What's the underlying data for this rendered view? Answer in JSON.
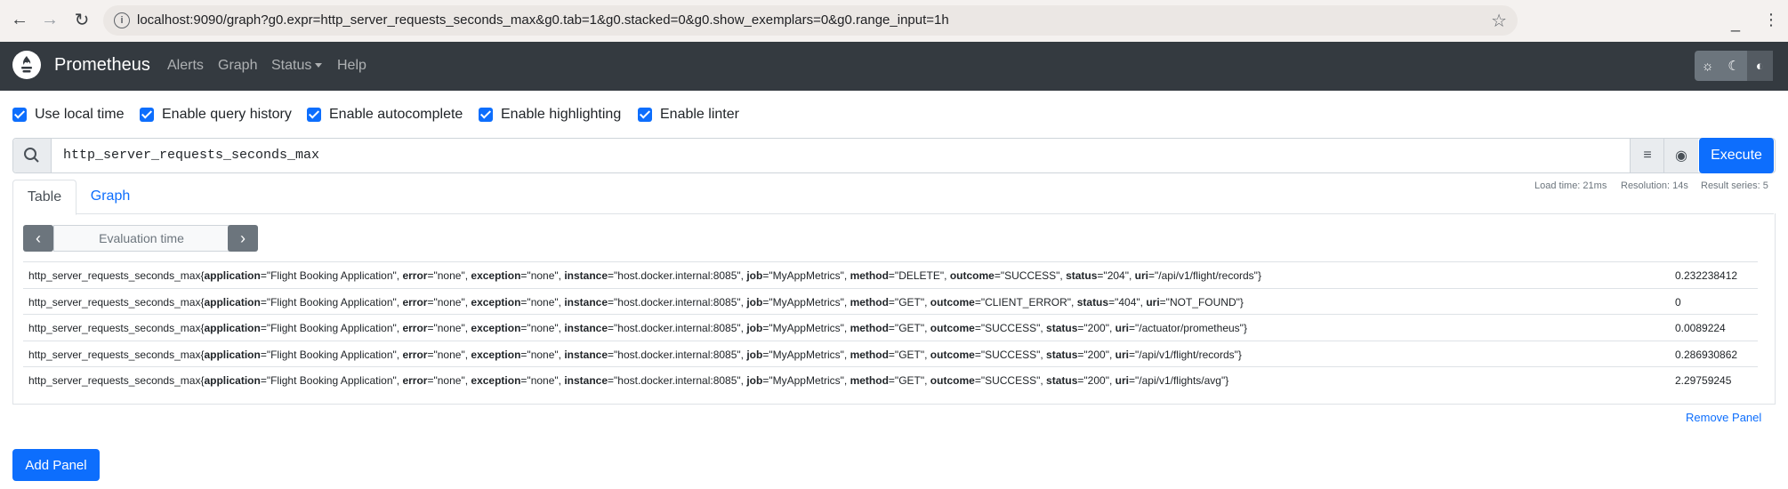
{
  "browser": {
    "url": "localhost:9090/graph?g0.expr=http_server_requests_seconds_max&g0.tab=1&g0.stacked=0&g0.show_exemplars=0&g0.range_input=1h"
  },
  "navbar": {
    "brand": "Prometheus",
    "links": [
      "Alerts",
      "Graph",
      "Status",
      "Help"
    ]
  },
  "options": [
    "Use local time",
    "Enable query history",
    "Enable autocomplete",
    "Enable highlighting",
    "Enable linter"
  ],
  "query": {
    "expression": "http_server_requests_seconds_max",
    "execute_label": "Execute"
  },
  "stats": {
    "load_time": "Load time: 21ms",
    "resolution": "Resolution: 14s",
    "result_series": "Result series: 5"
  },
  "tabs": [
    "Table",
    "Graph"
  ],
  "eval_time_placeholder": "Evaluation time",
  "results": [
    {
      "name": "http_server_requests_seconds_max",
      "labels": [
        {
          "k": "application",
          "v": "Flight Booking Application"
        },
        {
          "k": "error",
          "v": "none"
        },
        {
          "k": "exception",
          "v": "none"
        },
        {
          "k": "instance",
          "v": "host.docker.internal:8085"
        },
        {
          "k": "job",
          "v": "MyAppMetrics"
        },
        {
          "k": "method",
          "v": "DELETE"
        },
        {
          "k": "outcome",
          "v": "SUCCESS"
        },
        {
          "k": "status",
          "v": "204"
        },
        {
          "k": "uri",
          "v": "/api/v1/flight/records"
        }
      ],
      "value": "0.232238412"
    },
    {
      "name": "http_server_requests_seconds_max",
      "labels": [
        {
          "k": "application",
          "v": "Flight Booking Application"
        },
        {
          "k": "error",
          "v": "none"
        },
        {
          "k": "exception",
          "v": "none"
        },
        {
          "k": "instance",
          "v": "host.docker.internal:8085"
        },
        {
          "k": "job",
          "v": "MyAppMetrics"
        },
        {
          "k": "method",
          "v": "GET"
        },
        {
          "k": "outcome",
          "v": "CLIENT_ERROR"
        },
        {
          "k": "status",
          "v": "404"
        },
        {
          "k": "uri",
          "v": "NOT_FOUND"
        }
      ],
      "value": "0"
    },
    {
      "name": "http_server_requests_seconds_max",
      "labels": [
        {
          "k": "application",
          "v": "Flight Booking Application"
        },
        {
          "k": "error",
          "v": "none"
        },
        {
          "k": "exception",
          "v": "none"
        },
        {
          "k": "instance",
          "v": "host.docker.internal:8085"
        },
        {
          "k": "job",
          "v": "MyAppMetrics"
        },
        {
          "k": "method",
          "v": "GET"
        },
        {
          "k": "outcome",
          "v": "SUCCESS"
        },
        {
          "k": "status",
          "v": "200"
        },
        {
          "k": "uri",
          "v": "/actuator/prometheus"
        }
      ],
      "value": "0.0089224"
    },
    {
      "name": "http_server_requests_seconds_max",
      "labels": [
        {
          "k": "application",
          "v": "Flight Booking Application"
        },
        {
          "k": "error",
          "v": "none"
        },
        {
          "k": "exception",
          "v": "none"
        },
        {
          "k": "instance",
          "v": "host.docker.internal:8085"
        },
        {
          "k": "job",
          "v": "MyAppMetrics"
        },
        {
          "k": "method",
          "v": "GET"
        },
        {
          "k": "outcome",
          "v": "SUCCESS"
        },
        {
          "k": "status",
          "v": "200"
        },
        {
          "k": "uri",
          "v": "/api/v1/flight/records"
        }
      ],
      "value": "0.286930862"
    },
    {
      "name": "http_server_requests_seconds_max",
      "labels": [
        {
          "k": "application",
          "v": "Flight Booking Application"
        },
        {
          "k": "error",
          "v": "none"
        },
        {
          "k": "exception",
          "v": "none"
        },
        {
          "k": "instance",
          "v": "host.docker.internal:8085"
        },
        {
          "k": "job",
          "v": "MyAppMetrics"
        },
        {
          "k": "method",
          "v": "GET"
        },
        {
          "k": "outcome",
          "v": "SUCCESS"
        },
        {
          "k": "status",
          "v": "200"
        },
        {
          "k": "uri",
          "v": "/api/v1/flights/avg"
        }
      ],
      "value": "2.29759245"
    }
  ],
  "remove_panel": "Remove Panel",
  "add_panel": "Add Panel"
}
